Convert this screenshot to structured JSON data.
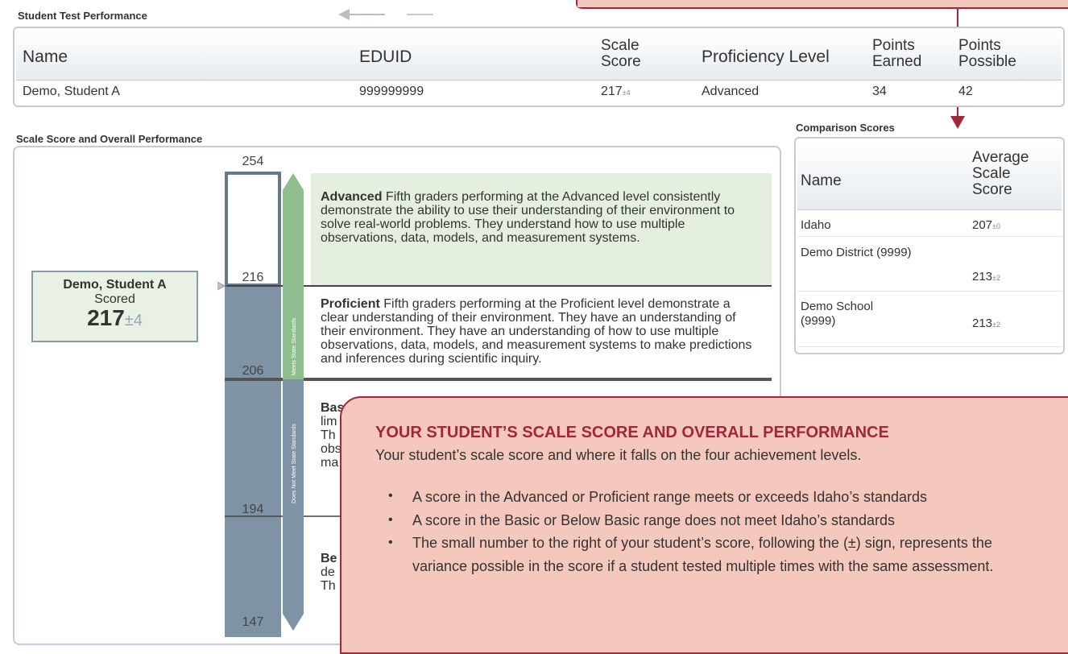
{
  "student_test_performance": {
    "section_title": "Student Test Performance",
    "headers": {
      "name": "Name",
      "eduid": "EDUID",
      "scale_score": "Scale Score",
      "proficiency": "Proficiency Level",
      "points_earned": "Points Earned",
      "points_possible": "Points Possible"
    },
    "row": {
      "name": "Demo, Student A",
      "eduid": "999999999",
      "scale_score": "217",
      "scale_pm": "±4",
      "proficiency": "Advanced",
      "points_earned": "34",
      "points_possible": "42"
    }
  },
  "overall": {
    "section_title": "Scale Score and Overall Performance",
    "ticks": {
      "t254": "254",
      "t216": "216",
      "t206": "206",
      "t194": "194",
      "t147": "147"
    },
    "student_box": {
      "name": "Demo, Student A",
      "scored_label": "Scored",
      "score": "217",
      "pm": "±4"
    },
    "meets_label": "Meets State Standards",
    "not_meet_label": "Does Not Meet State Standards",
    "levels": {
      "advanced": {
        "name": "Advanced",
        "text": " Fifth graders performing at the Advanced level consistently demonstrate the ability to use their understanding of their environment to solve real-world problems. They understand how to use multiple observations, data, models, and measurement systems."
      },
      "proficient": {
        "name": "Proficient",
        "text": " Fifth graders performing at the Proficient level demonstrate a clear understanding of their environment. They have an understanding of their environment. They have an understanding of how to use multiple observations, data, models, and measurement systems to make predictions and inferences during scientific inquiry."
      },
      "basic_frag": [
        "Bas",
        "lim",
        "Th",
        "obs",
        "ma"
      ],
      "below_frag": [
        "Be",
        "de",
        "Th"
      ]
    }
  },
  "comparison": {
    "section_title": "Comparison Scores",
    "headers": {
      "name": "Name",
      "avg": [
        "Average",
        "Scale",
        "Score"
      ]
    },
    "rows": [
      {
        "name": "Idaho",
        "score": "207",
        "pm": "±0"
      },
      {
        "name": "Demo District (9999)",
        "score": "213",
        "pm": "±2"
      },
      {
        "name_lines": [
          "Demo School",
          "(9999)"
        ],
        "score": "213",
        "pm": "±2"
      }
    ]
  },
  "callout": {
    "title": "YOUR STUDENT’S SCALE SCORE AND OVERALL PERFORMANCE",
    "intro": "Your student’s scale score and where it falls on the four achievement levels.",
    "bullets": [
      "A score in the Advanced or Proficient range meets or exceeds Idaho’s standards",
      "A score in the Basic or Below Basic range does not meet Idaho’s standards",
      "The small number to the right of your student’s score, following the (±) sign, represents the variance possible in the score if a student tested multiple times with the same assessment."
    ],
    "bullet_glyph": "•"
  },
  "colors": {
    "accent": "#a4263a",
    "callout_bg": "#f4c8bc",
    "advanced_bg": "#e4efe0",
    "bar_slate": "#7e93a4",
    "bar_green": "#8fbf8f"
  }
}
